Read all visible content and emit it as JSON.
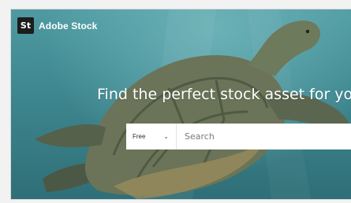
{
  "brand": {
    "logo_mark": "St",
    "name": "Adobe Stock"
  },
  "hero": {
    "headline": "Find the perfect stock asset for your"
  },
  "search": {
    "asset_filter": {
      "selected": "Free",
      "icon": "chevron-down-icon"
    },
    "placeholder": "Search"
  },
  "colors": {
    "water": "#3e868f",
    "turtle": "#5e6a52",
    "search_bg": "#ffffff"
  }
}
